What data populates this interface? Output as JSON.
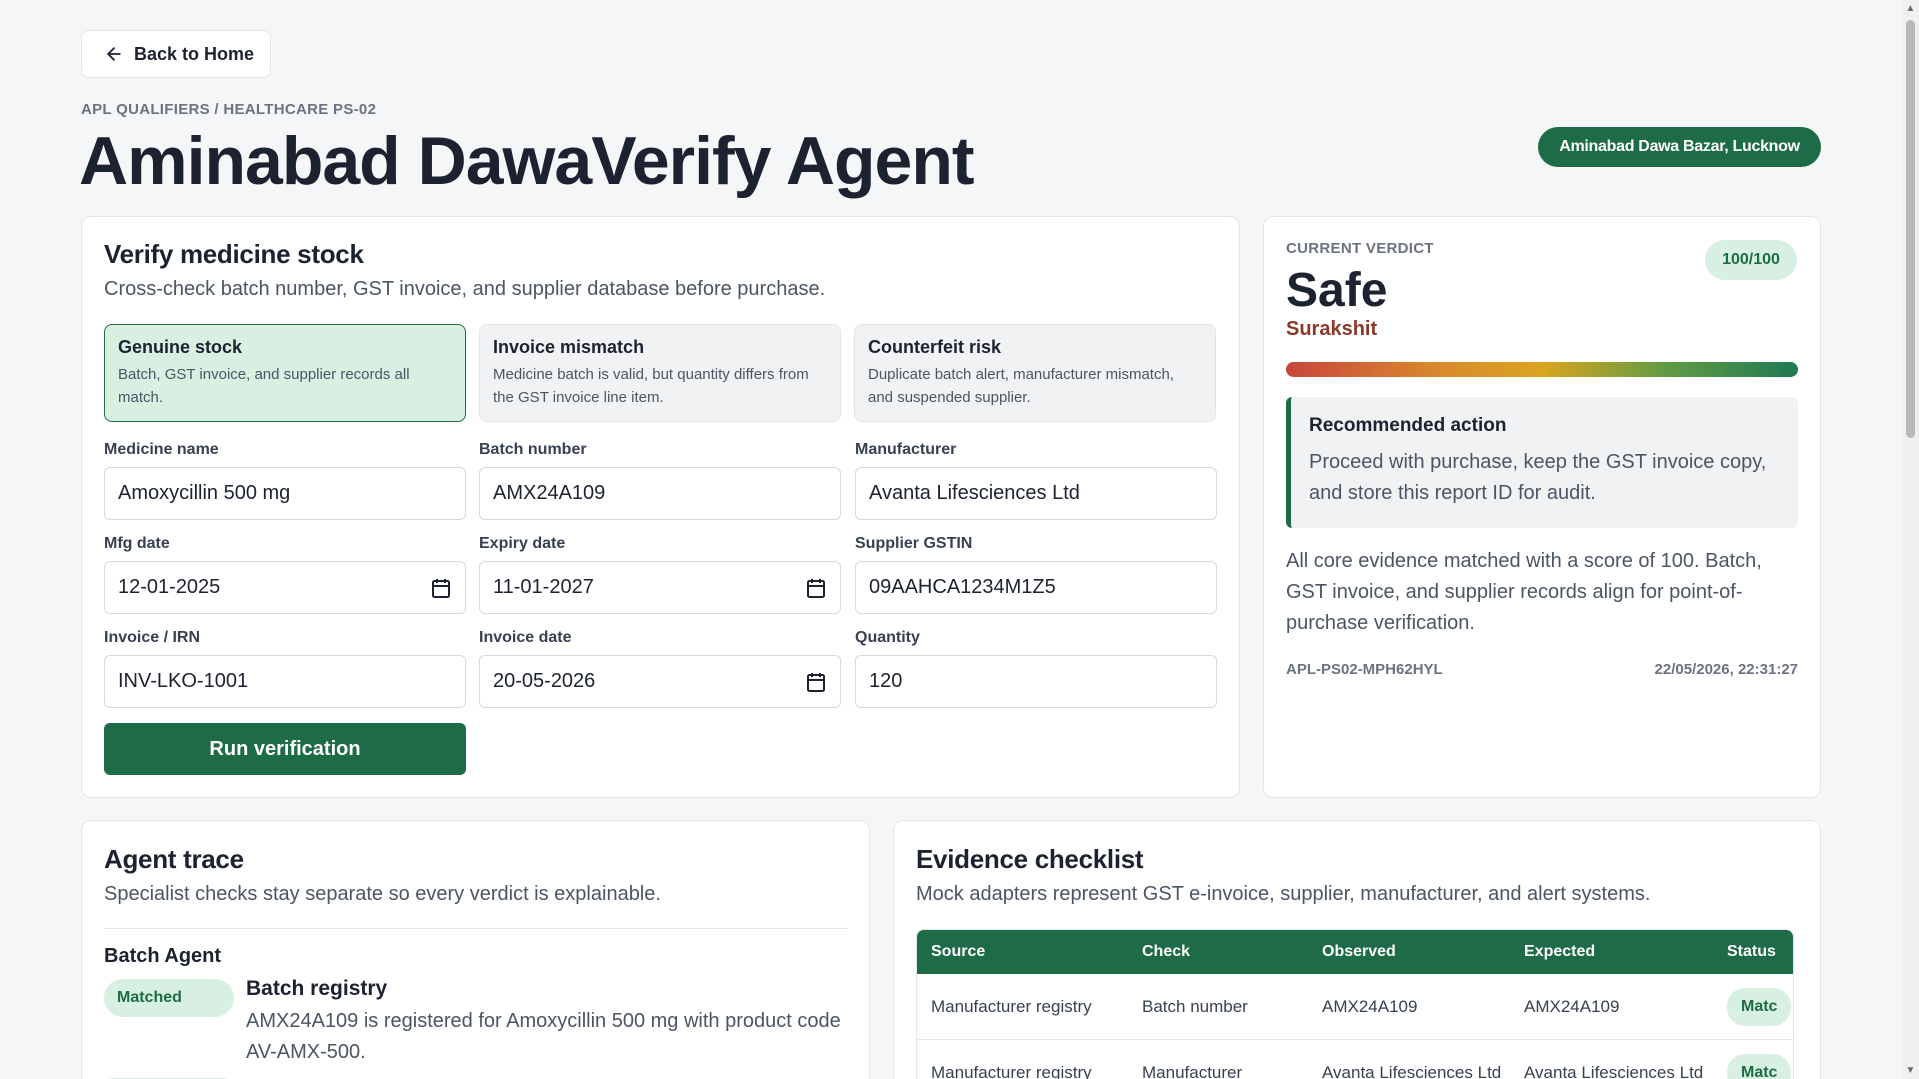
{
  "nav": {
    "back_label": "Back to Home"
  },
  "header": {
    "eyebrow": "APL QUALIFIERS / HEALTHCARE PS-02",
    "title": "Aminabad DawaVerify Agent",
    "location": "Aminabad Dawa Bazar, Lucknow"
  },
  "verify": {
    "title": "Verify medicine stock",
    "subtitle": "Cross-check batch number, GST invoice, and supplier database before purchase.",
    "scenarios": [
      {
        "title": "Genuine stock",
        "desc": "Batch, GST invoice, and supplier records all match."
      },
      {
        "title": "Invoice mismatch",
        "desc": "Medicine batch is valid, but quantity differs from the GST invoice line item."
      },
      {
        "title": "Counterfeit risk",
        "desc": "Duplicate batch alert, manufacturer mismatch, and suspended supplier."
      }
    ],
    "fields": {
      "medicine_name": {
        "label": "Medicine name",
        "value": "Amoxycillin 500 mg"
      },
      "batch_number": {
        "label": "Batch number",
        "value": "AMX24A109"
      },
      "manufacturer": {
        "label": "Manufacturer",
        "value": "Avanta Lifesciences Ltd"
      },
      "mfg_date": {
        "label": "Mfg date",
        "value": "12-01-2025"
      },
      "expiry_date": {
        "label": "Expiry date",
        "value": "11-01-2027"
      },
      "supplier_gstin": {
        "label": "Supplier GSTIN",
        "value": "09AAHCA1234M1Z5"
      },
      "invoice_irn": {
        "label": "Invoice / IRN",
        "value": "INV-LKO-1001"
      },
      "invoice_date": {
        "label": "Invoice date",
        "value": "20-05-2026"
      },
      "quantity": {
        "label": "Quantity",
        "value": "120"
      }
    },
    "run_label": "Run verification"
  },
  "verdict": {
    "eyebrow": "CURRENT VERDICT",
    "score": "100/100",
    "score_value": 100,
    "label": "Safe",
    "local_label": "Surakshit",
    "action_title": "Recommended action",
    "action_text": "Proceed with purchase, keep the GST invoice copy, and store this report ID for audit.",
    "summary": "All core evidence matched with a score of 100. Batch, GST invoice, and supplier records align for point-of-purchase verification.",
    "report_id": "APL-PS02-MPH62HYL",
    "timestamp": "22/05/2026, 22:31:27"
  },
  "trace": {
    "title": "Agent trace",
    "subtitle": "Specialist checks stay separate so every verdict is explainable.",
    "agent": "Batch Agent",
    "status": "Matched",
    "check_title": "Batch registry",
    "check_detail": "AMX24A109 is registered for Amoxycillin 500 mg with product code AV-AMX-500."
  },
  "evidence": {
    "title": "Evidence checklist",
    "subtitle": "Mock adapters represent GST e-invoice, supplier, manufacturer, and alert systems.",
    "columns": [
      "Source",
      "Check",
      "Observed",
      "Expected",
      "Status"
    ],
    "rows": [
      {
        "source": "Manufacturer registry",
        "check": "Batch number",
        "observed": "AMX24A109",
        "expected": "AMX24A109",
        "status": "Matc"
      },
      {
        "source": "Manufacturer registry",
        "check": "Manufacturer",
        "observed": "Avanta Lifesciences Ltd",
        "expected": "Avanta Lifesciences Ltd",
        "status": "Matc"
      }
    ]
  },
  "colors": {
    "accent": "#1e6b47",
    "accent_light": "#d8f0e1",
    "verdict_local": "#8a3a2a"
  }
}
